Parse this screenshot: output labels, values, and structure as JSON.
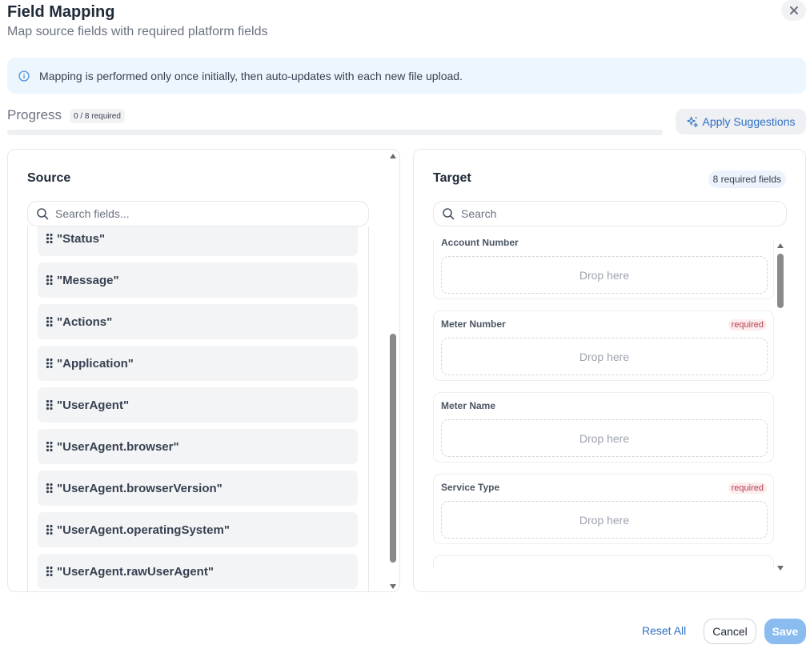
{
  "header": {
    "title": "Field Mapping",
    "subtitle": "Map source fields with required platform fields"
  },
  "info_banner": {
    "text": "Mapping is performed only once initially, then auto-updates with each new file upload.",
    "icon": "info-icon"
  },
  "progress": {
    "label": "Progress",
    "badge": "0 / 8 required",
    "mapped": 0,
    "required_total": 8,
    "percent": 0
  },
  "apply_suggestions": {
    "label": "Apply Suggestions",
    "icon": "sparkle-icon"
  },
  "source": {
    "title": "Source",
    "search_placeholder": "Search fields...",
    "items": [
      {
        "label": "\"Status\""
      },
      {
        "label": "\"Message\""
      },
      {
        "label": "\"Actions\""
      },
      {
        "label": "\"Application\""
      },
      {
        "label": "\"UserAgent\""
      },
      {
        "label": "\"UserAgent.browser\""
      },
      {
        "label": "\"UserAgent.browserVersion\""
      },
      {
        "label": "\"UserAgent.operatingSystem\""
      },
      {
        "label": "\"UserAgent.rawUserAgent\""
      }
    ]
  },
  "target": {
    "title": "Target",
    "required_badge": "8 required fields",
    "search_placeholder": "Search",
    "fields": [
      {
        "name": "Account Number",
        "required": false,
        "drop_text": "Drop here"
      },
      {
        "name": "Meter Number",
        "required": true,
        "required_text": "required",
        "drop_text": "Drop here"
      },
      {
        "name": "Meter Name",
        "required": false,
        "drop_text": "Drop here"
      },
      {
        "name": "Service Type",
        "required": true,
        "required_text": "required",
        "drop_text": "Drop here"
      }
    ]
  },
  "footer": {
    "reset_label": "Reset All",
    "cancel_label": "Cancel",
    "save_label": "Save"
  },
  "colors": {
    "accent": "#2f6fc4",
    "save_disabled": "#8bbcf0",
    "info_bg": "#eef6fd",
    "required_text": "#b4404f"
  }
}
